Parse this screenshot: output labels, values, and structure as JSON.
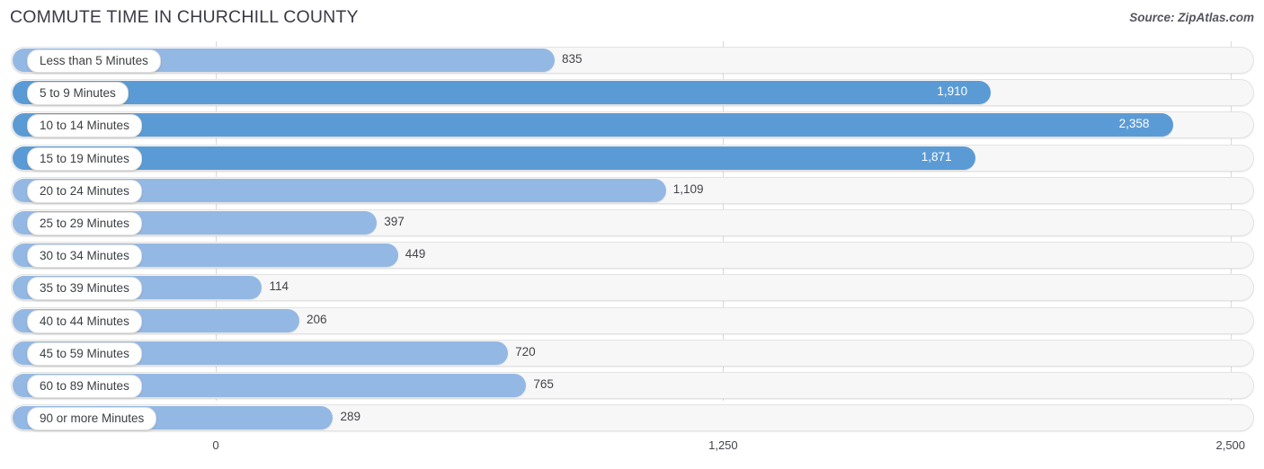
{
  "header": {
    "title": "COMMUTE TIME IN CHURCHILL COUNTY",
    "source": "Source: ZipAtlas.com"
  },
  "chart_data": {
    "type": "bar",
    "orientation": "horizontal",
    "title": "COMMUTE TIME IN CHURCHILL COUNTY",
    "xlabel": "",
    "ylabel": "",
    "xlim": [
      0,
      2500
    ],
    "grid": true,
    "legend": null,
    "xticks": [
      "0",
      "1,250",
      "2,500"
    ],
    "xtick_values": [
      0,
      1250,
      2500
    ],
    "categories": [
      "Less than 5 Minutes",
      "5 to 9 Minutes",
      "10 to 14 Minutes",
      "15 to 19 Minutes",
      "20 to 24 Minutes",
      "25 to 29 Minutes",
      "30 to 34 Minutes",
      "35 to 39 Minutes",
      "40 to 44 Minutes",
      "45 to 59 Minutes",
      "60 to 89 Minutes",
      "90 or more Minutes"
    ],
    "values": [
      835,
      1910,
      2358,
      1871,
      1109,
      397,
      449,
      114,
      206,
      720,
      765,
      289
    ],
    "value_labels": [
      "835",
      "1,910",
      "2,358",
      "1,871",
      "1,109",
      "397",
      "449",
      "114",
      "206",
      "720",
      "765",
      "289"
    ],
    "label_inside": [
      false,
      true,
      true,
      true,
      false,
      false,
      false,
      false,
      false,
      false,
      false,
      false
    ],
    "bar_colors": [
      "#94b8e4",
      "#5b9bd5",
      "#5b9bd5",
      "#5b9bd5",
      "#94b8e4",
      "#94b8e4",
      "#94b8e4",
      "#94b8e4",
      "#94b8e4",
      "#94b8e4",
      "#94b8e4",
      "#94b8e4"
    ]
  },
  "colors": {
    "bar_dark": "#5b9bd5",
    "bar_light": "#94b8e4",
    "track": "#f7f7f7",
    "gridline": "#d9d9d9",
    "text": "#3c4043"
  }
}
